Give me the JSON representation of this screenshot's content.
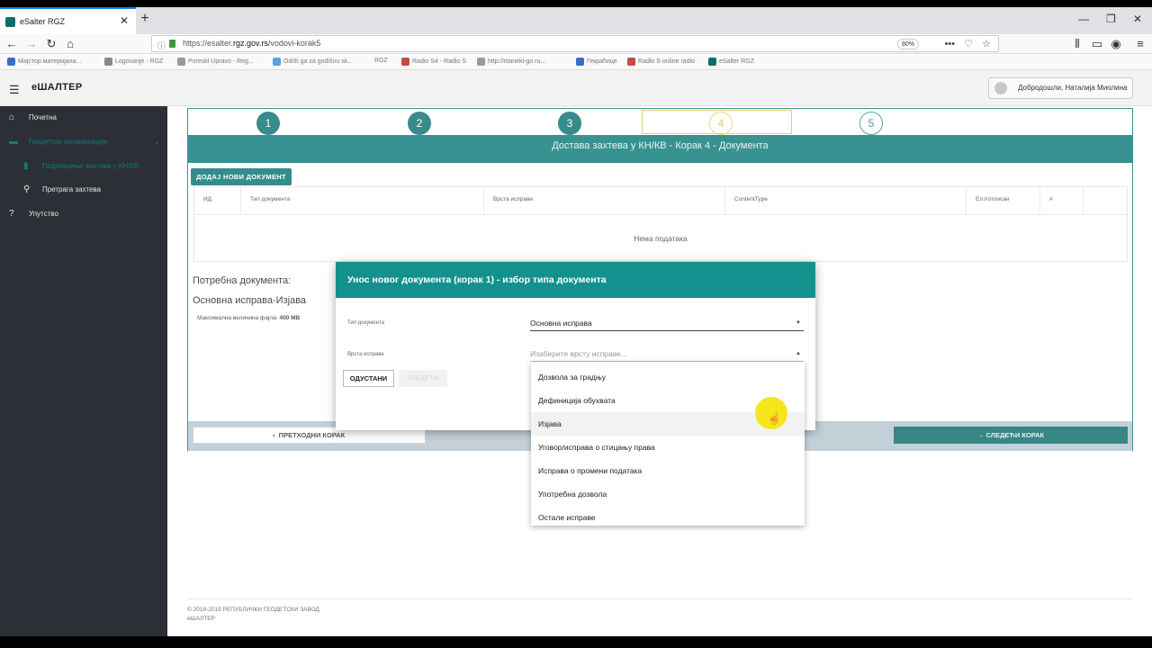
{
  "browser": {
    "tab_title": "eSalter RGZ",
    "url_prefix": "https://esalter.",
    "url_host": "rgz.gov.rs",
    "url_path": "/vodovi-korak5",
    "zoom": "80%",
    "bookmarks": [
      "Мајстор материјала...",
      "Logovanje - RGZ",
      "Poreski Upravo - Reg...",
      "Održi ga za godišnu sk...",
      "RGZ",
      "Radio S4 - Radio S",
      "http://ritaneki-go.ru...",
      "Гекраћице",
      "Radio S online radio",
      "eSalter RGZ"
    ],
    "bookmark_colors": [
      "#3b6cc9",
      "#888888",
      "#999999",
      "#5aa0e0",
      "#cccccc",
      "#c84a4a",
      "#999999",
      "#3b6cc9",
      "#c84a4a",
      "#0b6e6e"
    ]
  },
  "app": {
    "title": "еШАЛТЕР",
    "user_label": "Добродошли, Наталија Миолина"
  },
  "sidebar": {
    "items": [
      {
        "icon": "home-icon",
        "label": "Почетна"
      },
      {
        "icon": "folder-icon",
        "label": "Геодетске организације"
      },
      {
        "icon": "document-icon",
        "label": "Подношење захтева у КН/КВ"
      },
      {
        "icon": "search-icon",
        "label": "Претрага захтева"
      },
      {
        "icon": "help-icon",
        "label": "Упутство"
      }
    ]
  },
  "wizard": {
    "steps": [
      "1",
      "2",
      "3",
      "4",
      "5"
    ],
    "current_step": 4,
    "banner": "Достава захтева у КН/КВ - Корак 4 - Документа",
    "add_button": "ДОДАЈ НОВИ ДОКУМЕНТ",
    "table": {
      "columns": [
        "ИД",
        "Тип документа",
        "Врста исправе",
        "ContentType",
        "Ел.потписан",
        "#",
        ""
      ],
      "empty_text": "Нема података"
    },
    "required_title": "Потребна документа:",
    "required_item": "Основна исправа-Изјава",
    "max_size_label": "Максимална величина фајла:",
    "max_size_value": "400 MB",
    "prev_button": "ПРЕТХОДНИ КОРАК",
    "next_button": "СЛЕДЕЋИ КОРАК"
  },
  "dialog": {
    "title": "Унос новог документа (корак 1) - избор типа документа",
    "field1_label": "Тип документа",
    "field1_value": "Основна исправа",
    "field2_label": "Врста исправе",
    "field2_placeholder": "Изаберите врсту исправе...",
    "cancel_button": "ОДУСТАНИ",
    "next_button": "СЛЕДЕЋА",
    "options": [
      "Дозвола за градњу",
      "Дефиниција обухвата",
      "Изјава",
      "Уговор/исправа о стицању права",
      "Исправа о промени података",
      "Употребна дозвола",
      "Остале исправе"
    ],
    "highlighted_option": 2
  },
  "footer": {
    "line1": "© 2018-2019 РЕПУБЛИЧКИ ГЕОДЕТСКИ ЗАВОД",
    "line2": "еШАЛТЕР"
  },
  "colors": {
    "teal": "#0d7a7a",
    "sidebar": "#2c2f36",
    "cursor_highlight": "#f5e51b"
  }
}
